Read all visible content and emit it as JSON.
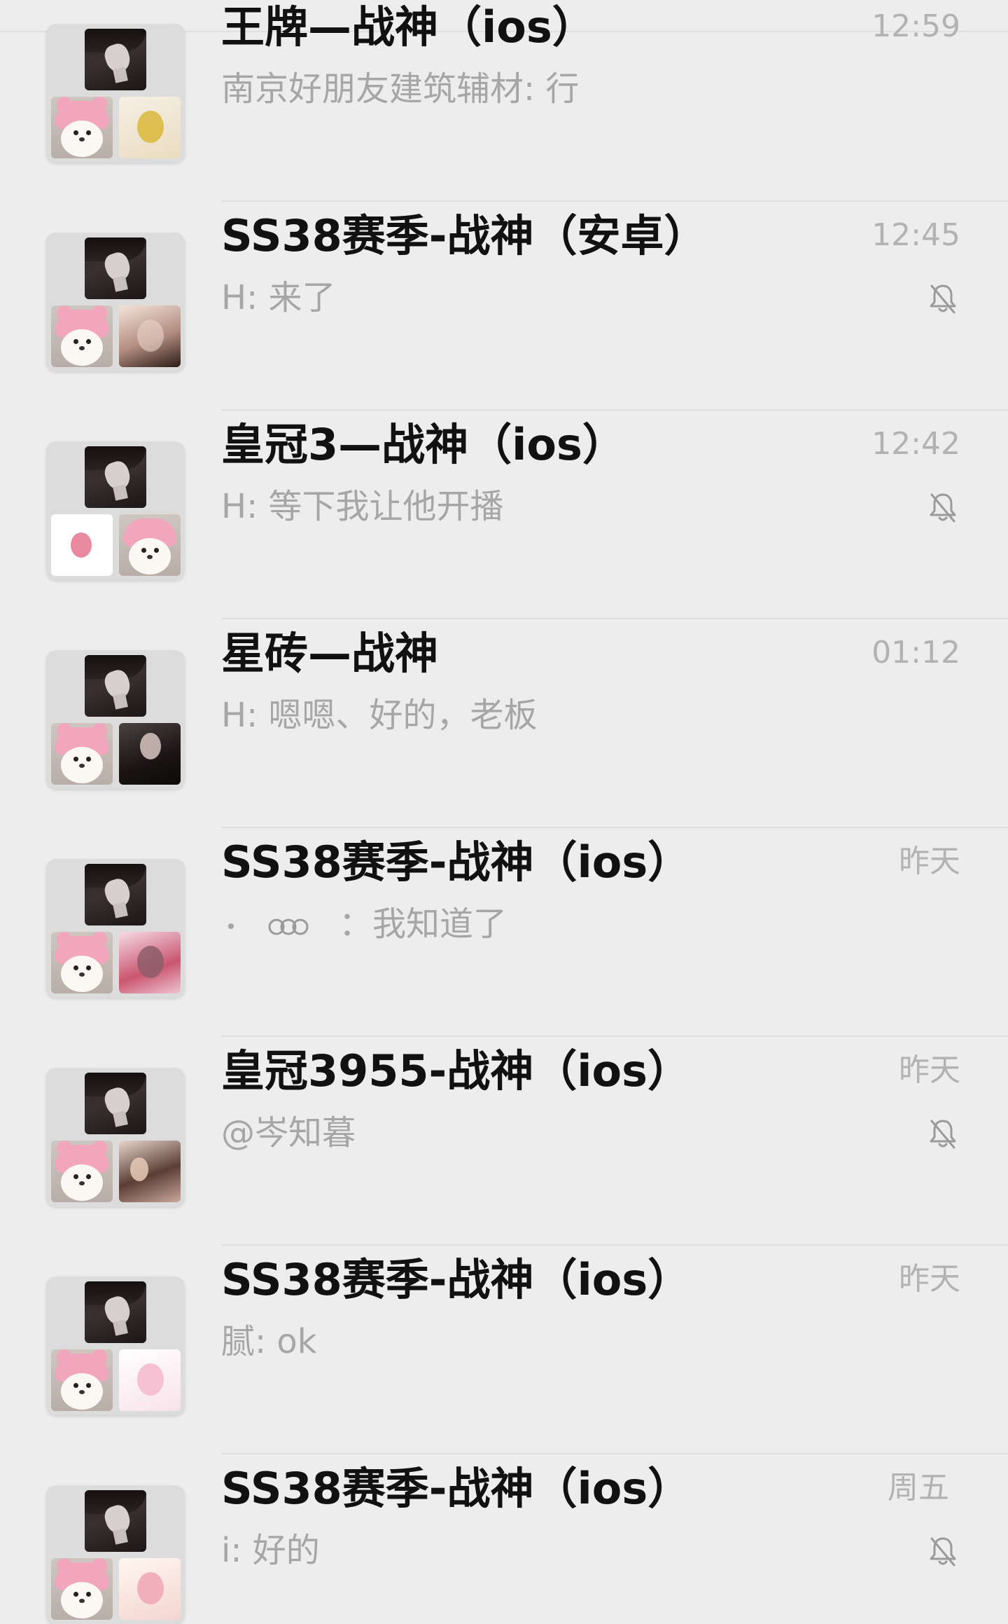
{
  "chats": [
    {
      "title": "王牌—战神（ios）",
      "preview": "南京好朋友建筑辅材: 行",
      "time": "12:59",
      "muted": false
    },
    {
      "title": "SS38赛季-战神（安卓）",
      "preview": "H: 来了",
      "time": "12:45",
      "muted": true
    },
    {
      "title": "皇冠3—战神（ios）",
      "preview": "H: 等下我让他开播",
      "time": "12:42",
      "muted": true
    },
    {
      "title": "星砖—战神",
      "preview": "H: 嗯嗯、好的，老板",
      "time": "01:12",
      "muted": false
    },
    {
      "title": "SS38赛季-战神（ios）",
      "preview": "：我知道了",
      "time": "昨天",
      "muted": false
    },
    {
      "title": "皇冠3955-战神（ios）",
      "preview": "@岑知暮",
      "time": "昨天",
      "muted": true
    },
    {
      "title": "SS38赛季-战神（ios）",
      "preview": "腻: ok",
      "time": "昨天",
      "muted": false
    },
    {
      "title": "SS38赛季-战神（ios）",
      "preview": "i: 好的",
      "time": "周五",
      "muted": true
    }
  ],
  "icons": {
    "mute": "bell-slash-icon",
    "avatar": "group-avatar-grid"
  },
  "colors": {
    "background": "#ededed",
    "title": "#111111",
    "secondary": "#b2b2b2",
    "divider": "#dedede"
  }
}
